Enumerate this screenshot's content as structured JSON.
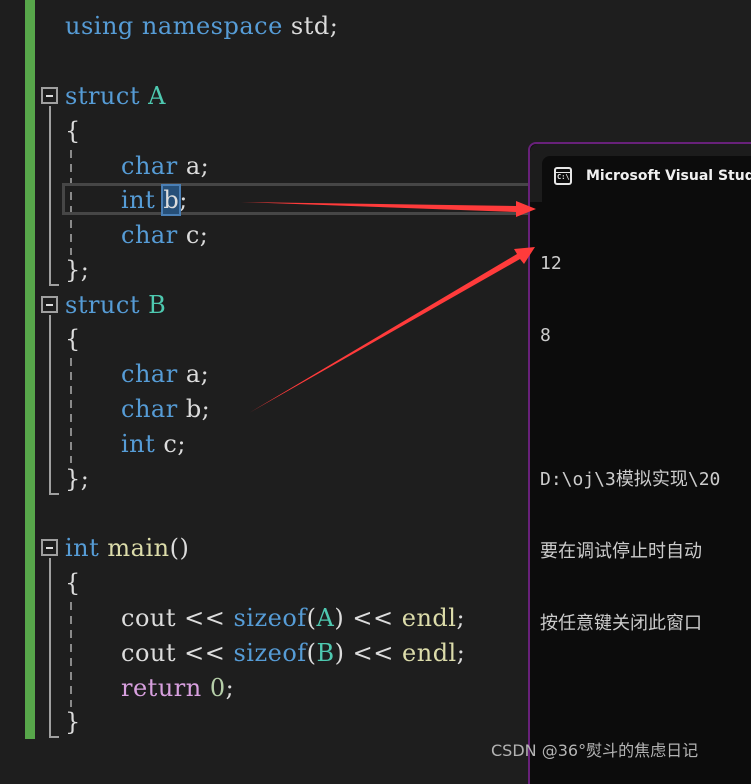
{
  "editor": {
    "lines": {
      "l1": {
        "kw1": "using",
        "kw2": "namespace",
        "rest": " std;"
      },
      "l2": {
        "kw": "struct",
        "name": "A"
      },
      "l3": {
        "brace": "{"
      },
      "l4": {
        "type": "char",
        "var": " a;"
      },
      "l5": {
        "type": "int",
        "sel": "b",
        "rest": ";"
      },
      "l6": {
        "type": "char",
        "var": " c;"
      },
      "l7": {
        "brace": "};"
      },
      "l8": {
        "kw": "struct",
        "name": "B"
      },
      "l9": {
        "brace": "{"
      },
      "l10": {
        "type": "char",
        "var": " a;"
      },
      "l11": {
        "type": "char",
        "var": " b;"
      },
      "l12": {
        "type": "int",
        "var": " c;"
      },
      "l13": {
        "brace": "};"
      },
      "l14": {
        "type": "int",
        "fn": "main",
        "paren": "()"
      },
      "l15": {
        "brace": "{"
      },
      "l16": {
        "cout": "cout",
        "op1": " << ",
        "sizeof": "sizeof",
        "open": "(",
        "arg": "A",
        "close": ")",
        "op2": " << ",
        "endl": "endl",
        "semi": ";"
      },
      "l17": {
        "cout": "cout",
        "op1": " << ",
        "sizeof": "sizeof",
        "open": "(",
        "arg": "B",
        "close": ")",
        "op2": " << ",
        "endl": "endl",
        "semi": ";"
      },
      "l18": {
        "ret": "return",
        "num": "0",
        "semi": ";"
      },
      "l19": {
        "brace": "}"
      }
    },
    "colors": {
      "change_bar": "#57a64a",
      "keyword": "#569cd6",
      "type_name": "#4ec9b0",
      "function": "#dcdcaa",
      "control": "#d8a0df"
    }
  },
  "console": {
    "icon_text": "C:\\",
    "title": "Microsoft Visual Studio 调试控制台",
    "output": [
      "12",
      "8",
      "",
      "D:\\oj\\3模拟实现\\20",
      "要在调试停止时自动",
      "按任意键关闭此窗口"
    ],
    "border_color": "#68217a"
  },
  "annotations": {
    "arrow_color": "#ff3b3b"
  },
  "watermark": "CSDN @36°熨斗的焦虑日记"
}
